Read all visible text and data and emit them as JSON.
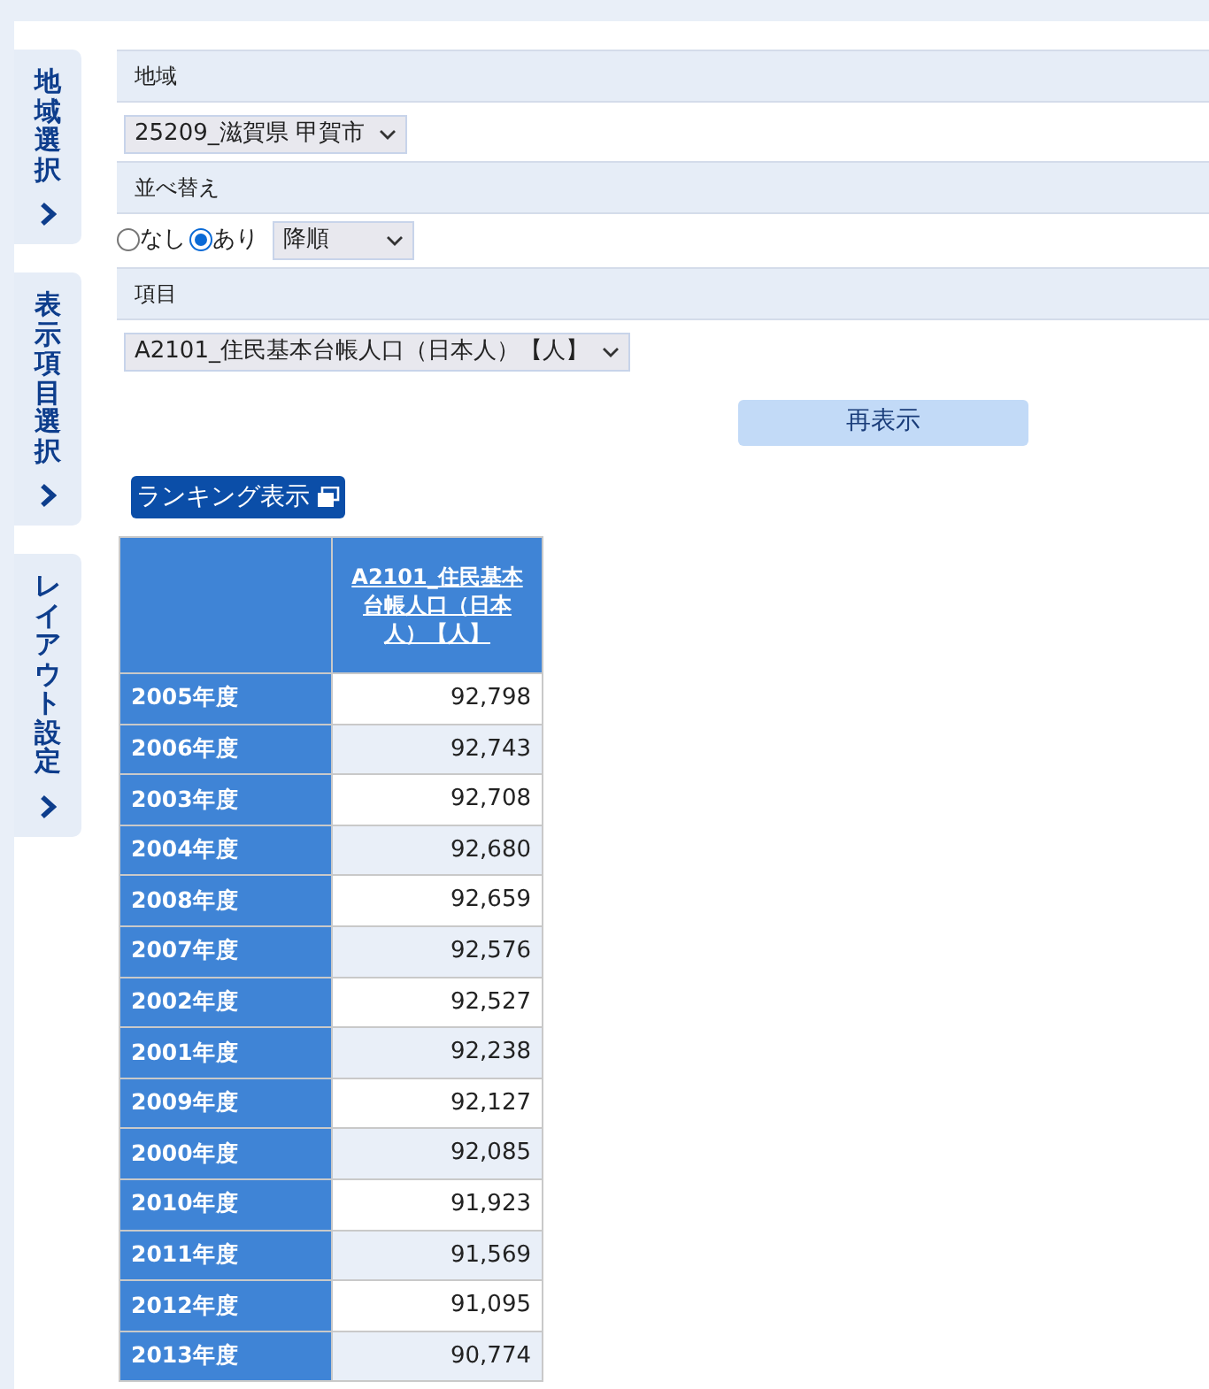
{
  "side_tabs": [
    {
      "label": "地域選択"
    },
    {
      "label": "表示項目選択"
    },
    {
      "label": "レイアウト設定"
    }
  ],
  "sections": [
    {
      "kind": "select",
      "heading": "地域",
      "value": "25209_滋賀県 甲賀市"
    },
    {
      "kind": "sort",
      "heading": "並べ替え",
      "options": [
        {
          "label": "なし",
          "selected": false
        },
        {
          "label": "あり",
          "selected": true
        }
      ],
      "value": "降順"
    },
    {
      "kind": "select",
      "heading": "項目",
      "value": "A2101_住民基本台帳人口（日本人）【人】"
    }
  ],
  "redisplay_button": "再表示",
  "ranking_button": "ランキング表示",
  "table": {
    "column_header": "A2101_住民基本台帳人口（日本人）【人】",
    "rows": [
      {
        "year": "2005年度",
        "value": "92,798"
      },
      {
        "year": "2006年度",
        "value": "92,743"
      },
      {
        "year": "2003年度",
        "value": "92,708"
      },
      {
        "year": "2004年度",
        "value": "92,680"
      },
      {
        "year": "2008年度",
        "value": "92,659"
      },
      {
        "year": "2007年度",
        "value": "92,576"
      },
      {
        "year": "2002年度",
        "value": "92,527"
      },
      {
        "year": "2001年度",
        "value": "92,238"
      },
      {
        "year": "2009年度",
        "value": "92,127"
      },
      {
        "year": "2000年度",
        "value": "92,085"
      },
      {
        "year": "2010年度",
        "value": "91,923"
      },
      {
        "year": "2011年度",
        "value": "91,569"
      },
      {
        "year": "2012年度",
        "value": "91,095"
      },
      {
        "year": "2013年度",
        "value": "90,774"
      }
    ]
  }
}
